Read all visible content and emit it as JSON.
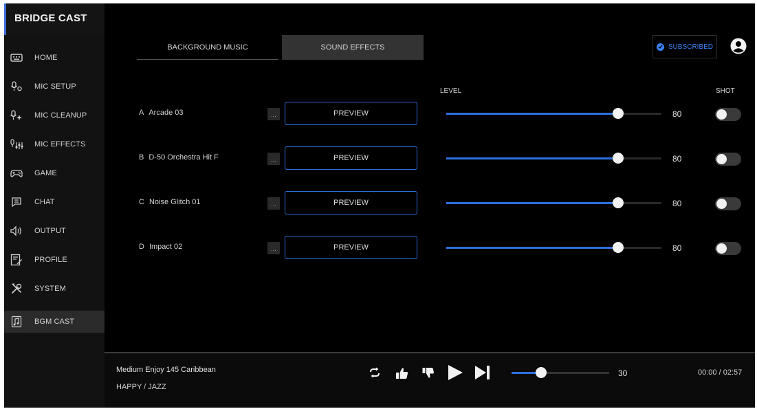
{
  "app": {
    "title": "BRIDGE CAST"
  },
  "sidebar": {
    "items": [
      {
        "label": "HOME",
        "icon": "keyboard-icon"
      },
      {
        "label": "MIC SETUP",
        "icon": "mic-settings-icon"
      },
      {
        "label": "MIC CLEANUP",
        "icon": "mic-sparkle-icon"
      },
      {
        "label": "MIC EFFECTS",
        "icon": "mic-effects-icon"
      },
      {
        "label": "GAME",
        "icon": "gamepad-icon"
      },
      {
        "label": "CHAT",
        "icon": "chat-icon"
      },
      {
        "label": "OUTPUT",
        "icon": "speaker-icon"
      },
      {
        "label": "PROFILE",
        "icon": "profile-edit-icon"
      },
      {
        "label": "SYSTEM",
        "icon": "tools-icon"
      },
      {
        "label": "BGM CAST",
        "icon": "music-note-icon",
        "active": true
      }
    ]
  },
  "tabs": {
    "bgm": "BACKGROUND MUSIC",
    "sfx": "SOUND EFFECTS",
    "active": "sfx"
  },
  "header": {
    "subscribed_label": "SUBSCRIBED"
  },
  "columns": {
    "level": "LEVEL",
    "shot": "SHOT"
  },
  "effects": [
    {
      "slot": "A",
      "name": "Arcade 03",
      "more": "...",
      "preview": "PREVIEW",
      "level": 80,
      "shot": false
    },
    {
      "slot": "B",
      "name": "D-50 Orchestra Hit F",
      "more": "...",
      "preview": "PREVIEW",
      "level": 80,
      "shot": false
    },
    {
      "slot": "C",
      "name": "Noise Glitch 01",
      "more": "...",
      "preview": "PREVIEW",
      "level": 80,
      "shot": false
    },
    {
      "slot": "D",
      "name": "Impact 02",
      "more": "...",
      "preview": "PREVIEW",
      "level": 80,
      "shot": false
    }
  ],
  "player": {
    "track": "Medium Enjoy 145 Caribbean",
    "genre": "HAPPY / JAZZ",
    "volume": 30,
    "time": "00:00 / 02:57"
  },
  "colors": {
    "accent": "#2f6fe0",
    "background": "#000000",
    "sidebar": "#121212"
  }
}
